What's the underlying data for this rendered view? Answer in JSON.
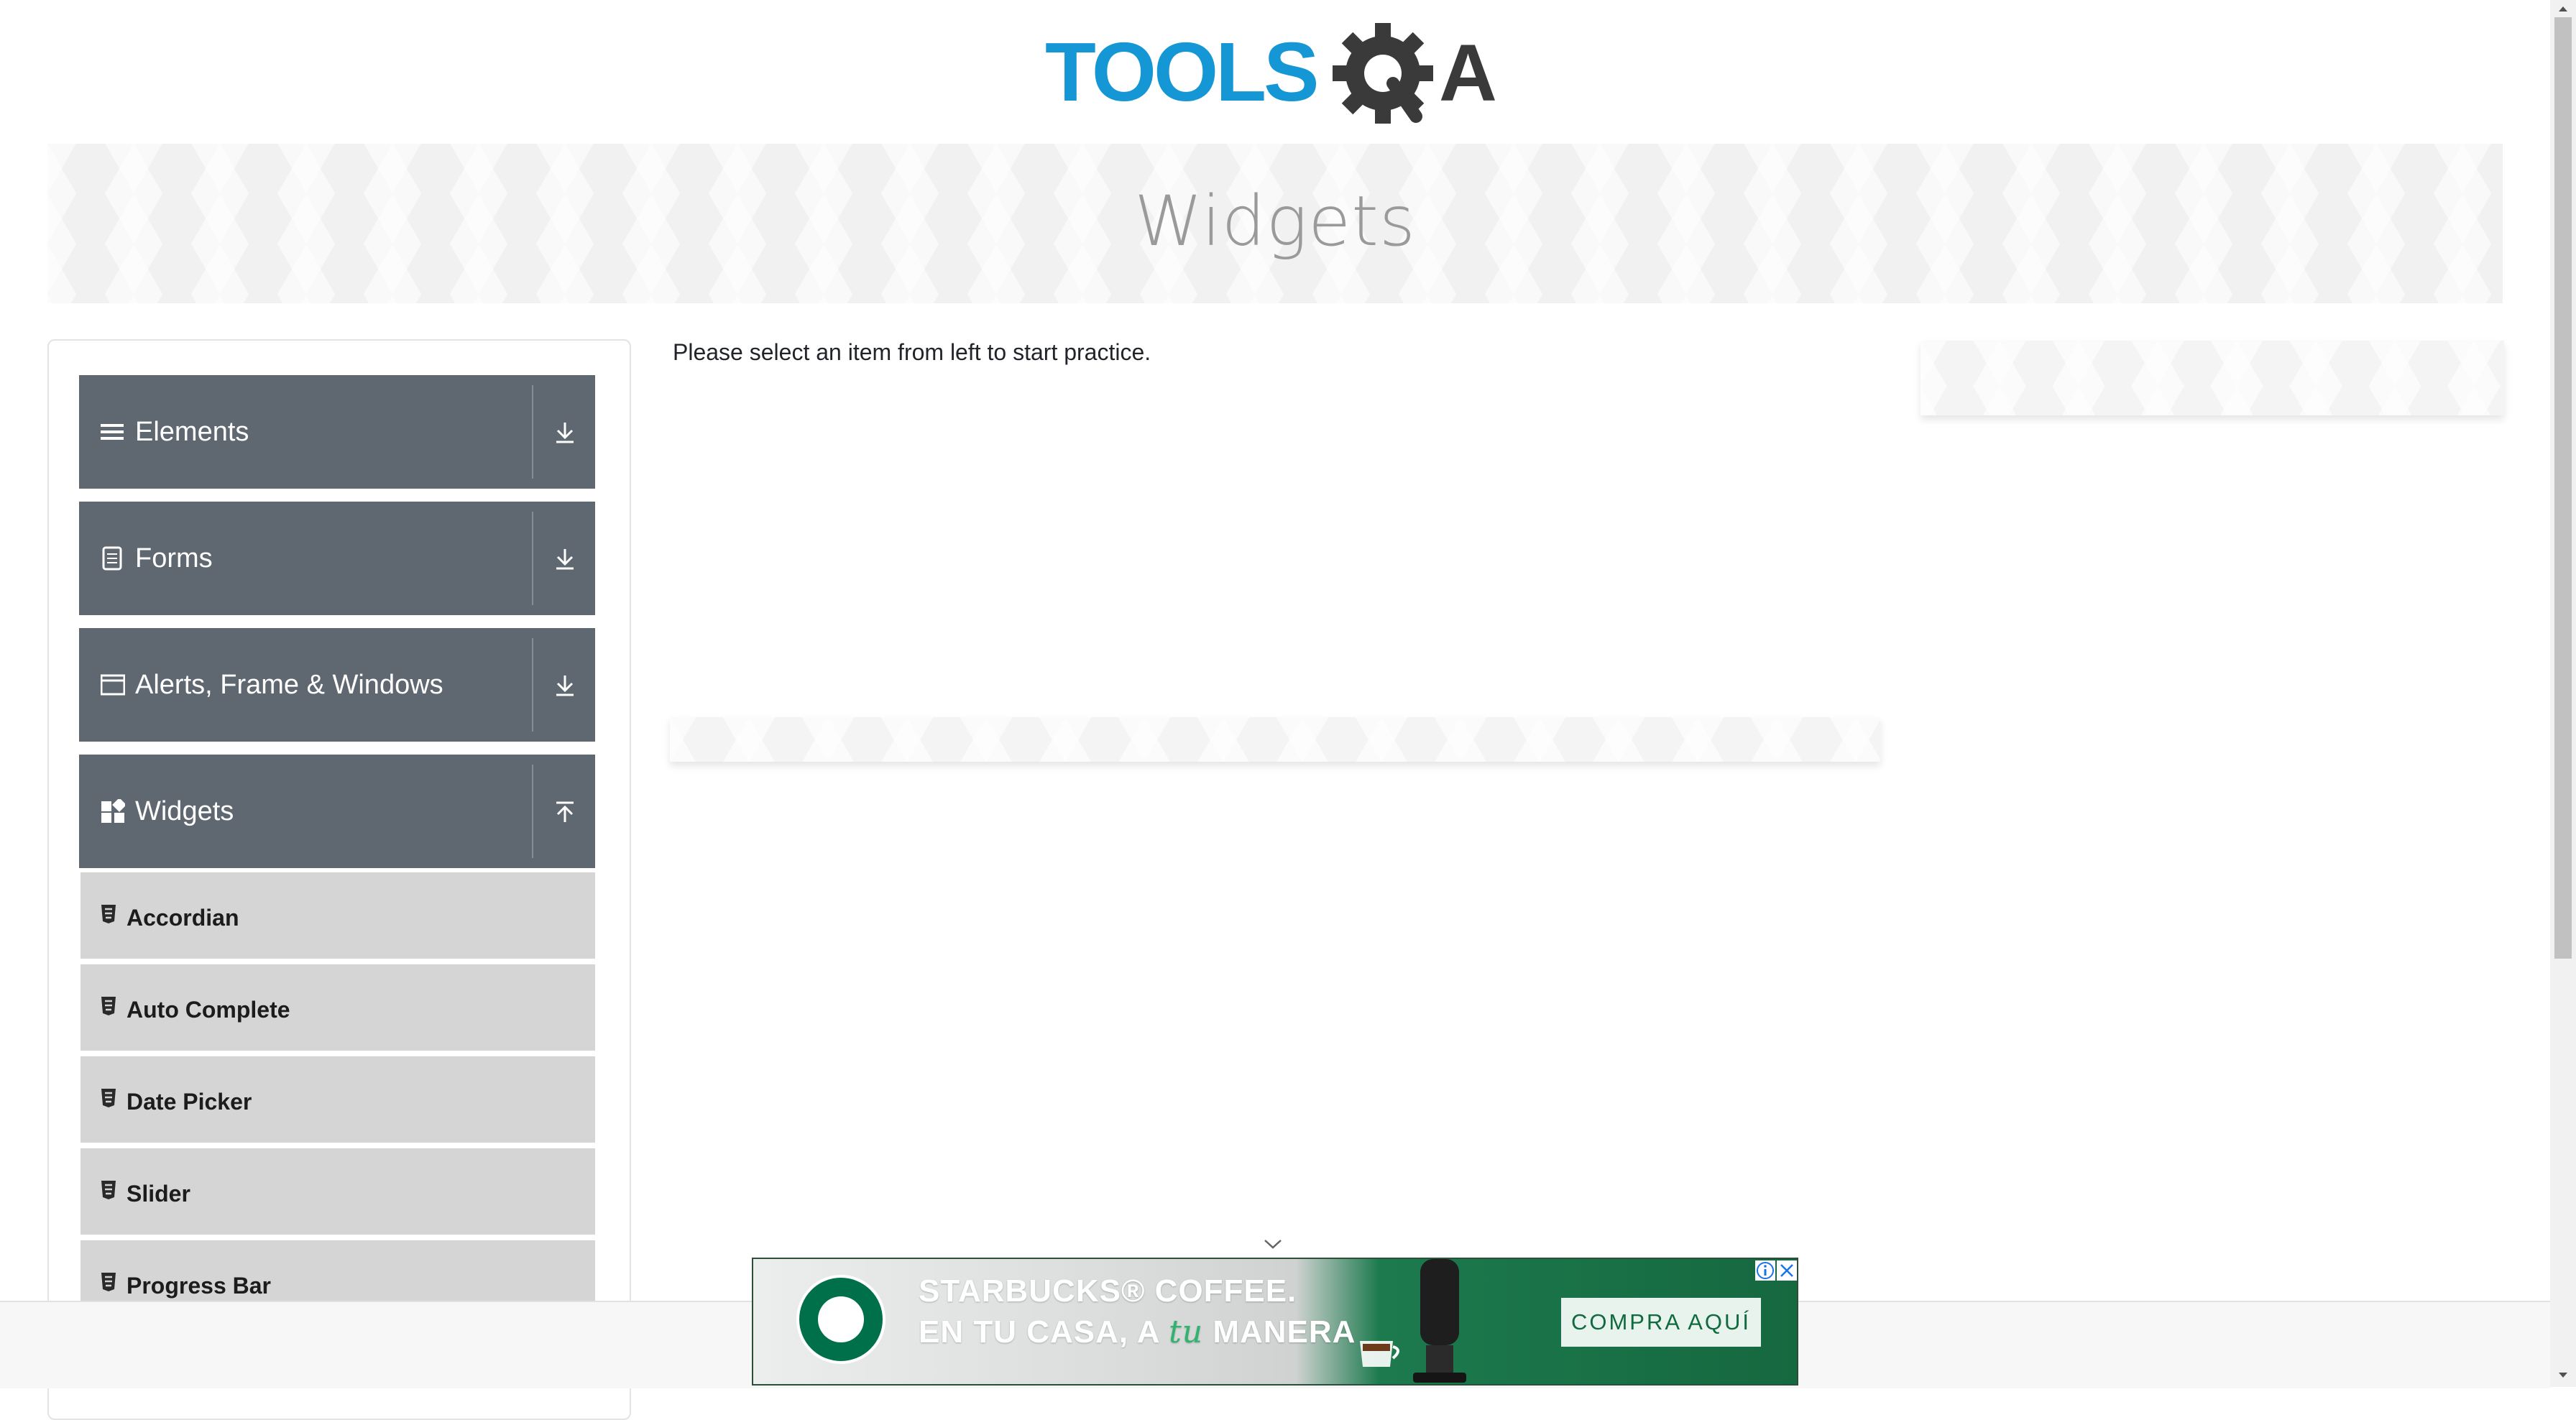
{
  "header": {
    "logo_text": "TOOLSQA",
    "logo_colors": {
      "tools": "#1497d4",
      "gear": "#3a3a3a",
      "q": "#3a3a3a",
      "a": "#3a3a3a"
    }
  },
  "banner": {
    "title": "Widgets"
  },
  "sidebar": {
    "groups": [
      {
        "label": "Elements",
        "icon": "hamburger-icon",
        "expanded": false
      },
      {
        "label": "Forms",
        "icon": "document-icon",
        "expanded": false
      },
      {
        "label": "Alerts, Frame & Windows",
        "icon": "window-icon",
        "expanded": false
      },
      {
        "label": "Widgets",
        "icon": "widgets-grid-icon",
        "expanded": true
      }
    ],
    "widgets_items": [
      {
        "label": "Accordian"
      },
      {
        "label": "Auto Complete"
      },
      {
        "label": "Date Picker"
      },
      {
        "label": "Slider"
      },
      {
        "label": "Progress Bar"
      }
    ]
  },
  "main": {
    "message": "Please select an item from left to start practice."
  },
  "ad": {
    "brand_line1": "STARBUCKS® COFFEE.",
    "brand_line2_pre": "EN TU CASA, A ",
    "brand_line2_em": "tu",
    "brand_line2_post": " MANERA",
    "cta": "COMPRA AQUÍ"
  },
  "colors": {
    "group_bg": "#5f6771",
    "subitem_bg": "#d5d5d5",
    "banner_title": "#9a9a9a"
  }
}
